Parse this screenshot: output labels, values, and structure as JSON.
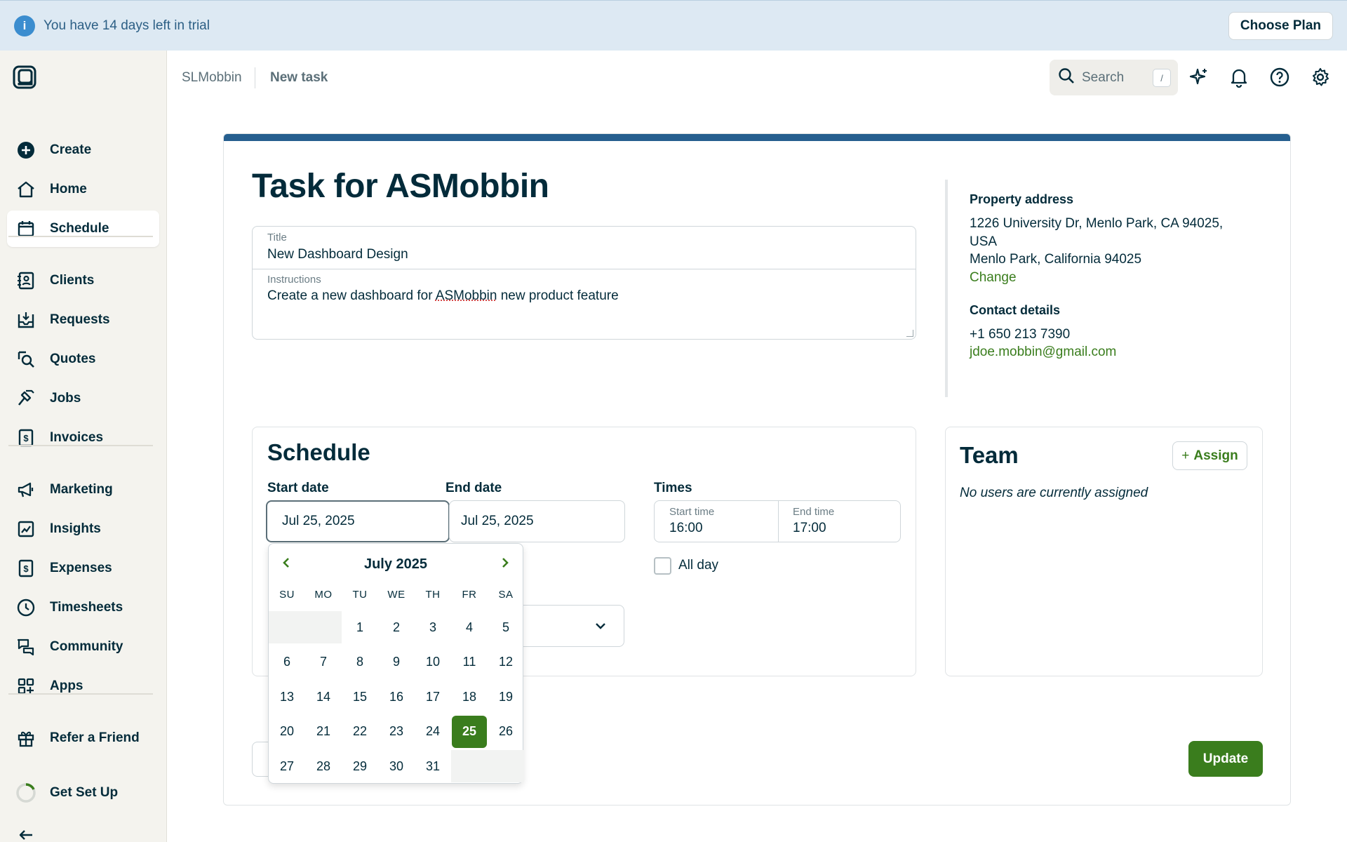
{
  "trial": {
    "message": "You have 14 days left in trial",
    "cta": "Choose Plan",
    "info_glyph": "i"
  },
  "sidebar": {
    "items": [
      {
        "label": "Create",
        "icon": "plus-circle-icon"
      },
      {
        "label": "Home",
        "icon": "home-icon"
      },
      {
        "label": "Schedule",
        "icon": "calendar-icon",
        "active": true
      },
      {
        "label": "Clients",
        "icon": "contacts-icon"
      },
      {
        "label": "Requests",
        "icon": "inbox-download-icon"
      },
      {
        "label": "Quotes",
        "icon": "quote-search-icon"
      },
      {
        "label": "Jobs",
        "icon": "hammer-icon"
      },
      {
        "label": "Invoices",
        "icon": "invoice-dollar-icon"
      },
      {
        "label": "Marketing",
        "icon": "megaphone-icon"
      },
      {
        "label": "Insights",
        "icon": "chart-icon"
      },
      {
        "label": "Expenses",
        "icon": "expense-dollar-icon"
      },
      {
        "label": "Timesheets",
        "icon": "clock-icon"
      },
      {
        "label": "Community",
        "icon": "chat-bubbles-icon"
      },
      {
        "label": "Apps",
        "icon": "apps-grid-icon"
      },
      {
        "label": "Refer a Friend",
        "icon": "gift-icon"
      },
      {
        "label": "Get Set Up",
        "icon": "progress-ring-icon"
      }
    ]
  },
  "topbar": {
    "breadcrumb_parent": "SLMobbin",
    "breadcrumb_current": "New task",
    "search_placeholder": "Search",
    "search_shortcut": "/"
  },
  "task": {
    "heading": "Task for ASMobbin",
    "title_label": "Title",
    "title_value": "New Dashboard Design",
    "instructions_label": "Instructions",
    "instructions_before": "Create a new dashboard for ",
    "instructions_flagged": "ASMobbin",
    "instructions_after": " new product feature"
  },
  "property": {
    "heading": "Property address",
    "line1": "1226 University Dr, Menlo Park, CA 94025,",
    "line2": "USA",
    "line3": "Menlo Park, California 94025",
    "change_link": "Change"
  },
  "contact": {
    "heading": "Contact details",
    "phone": "+1 650 213 7390",
    "email": "jdoe.mobbin@gmail.com"
  },
  "schedule": {
    "heading": "Schedule",
    "start_date_label": "Start date",
    "start_date": "Jul 25, 2025",
    "end_date_label": "End date",
    "end_date": "Jul 25, 2025",
    "times_label": "Times",
    "start_time_label": "Start time",
    "start_time": "16:00",
    "end_time_label": "End time",
    "end_time": "17:00",
    "all_day_label": "All day",
    "all_day_checked": false
  },
  "calendar": {
    "month": "July 2025",
    "weekdays": [
      "SU",
      "MO",
      "TU",
      "WE",
      "TH",
      "FR",
      "SA"
    ],
    "first_weekday_index": 2,
    "days_in_month": 31,
    "selected_day": 25
  },
  "team": {
    "heading": "Team",
    "assign_label": "Assign",
    "empty_message": "No users are currently assigned"
  },
  "actions": {
    "update_label": "Update"
  },
  "colors": {
    "accent_green": "#3a7d1d",
    "header_bar": "#265f8f",
    "banner_bg": "#dde9f3",
    "text_primary": "#032b3a"
  }
}
